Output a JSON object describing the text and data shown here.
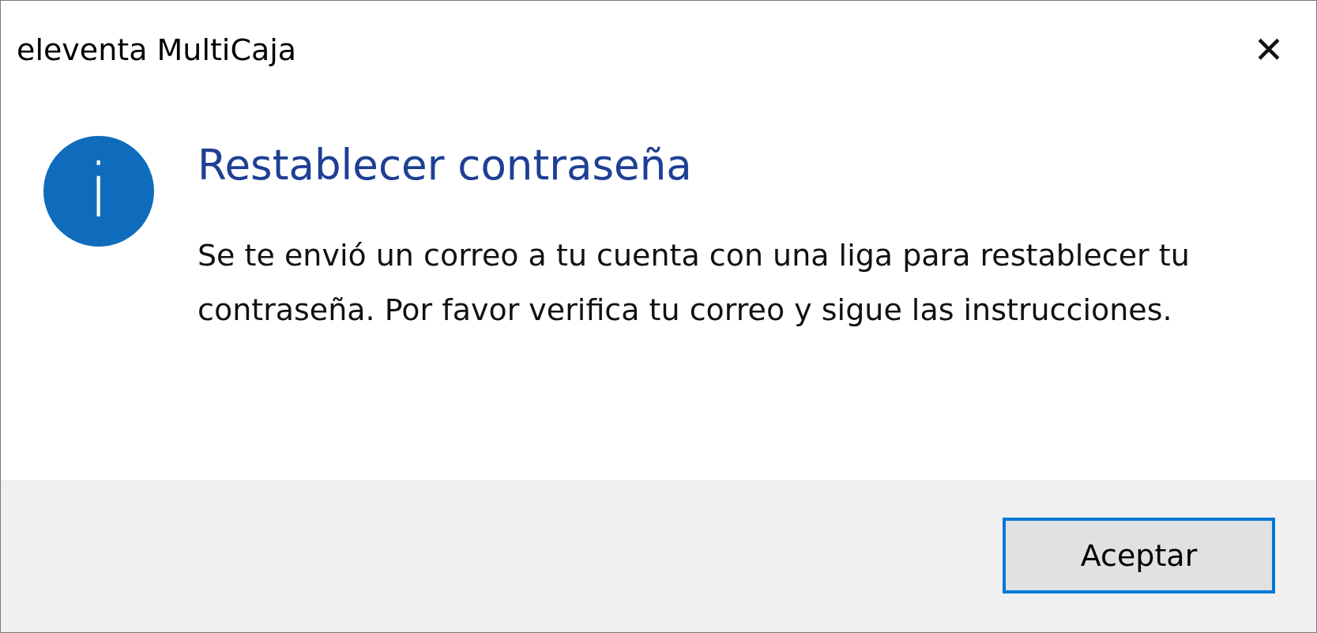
{
  "window": {
    "title": "eleventa MultiCaja",
    "close_symbol": "✕"
  },
  "message": {
    "kind": "info",
    "icon_symbol": "i",
    "heading": "Restablecer contraseña",
    "body": "Se te envió un correo a tu cuenta con una liga para restablecer tu contraseña. Por favor verifica tu correo y sigue las instrucciones."
  },
  "buttons": [
    {
      "label": "Aceptar",
      "focused": true
    }
  ]
}
